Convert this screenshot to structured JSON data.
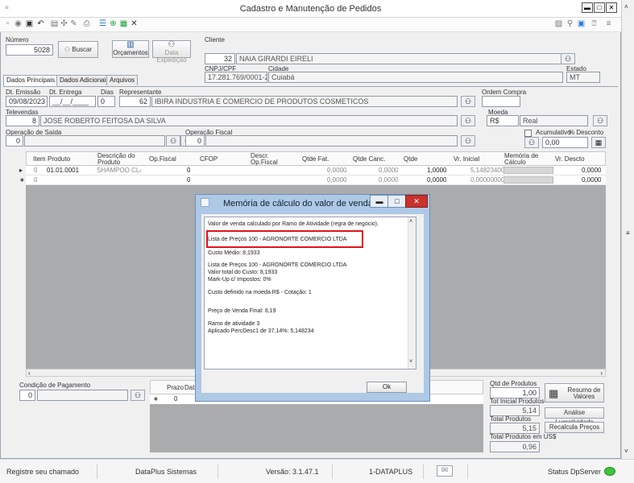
{
  "window": {
    "title": "Cadastro e Manutenção de Pedidos"
  },
  "header": {
    "numero_label": "Número",
    "numero_value": "5028",
    "buscar_label": "Buscar",
    "orcamentos_label": "Orçamentos",
    "data_expedicao_label": "Data Expedição",
    "cliente_label": "Cliente",
    "cliente_code": "32",
    "cliente_name": "NAIA GIRARDI EIRELI",
    "cnpj_label": "CNPJ/CPF",
    "cnpj_value": "17.281.769/0001-28",
    "cidade_label": "Cidade",
    "cidade_value": "Cuiabá",
    "estado_label": "Estado",
    "estado_value": "MT"
  },
  "tabs": [
    "Dados Principais",
    "Dados Adicionais",
    "Arquivos"
  ],
  "form": {
    "dt_emissao_label": "Dt. Emissão",
    "dt_emissao_value": "09/08/2023",
    "dt_entrega_label": "Dt. Entrega",
    "dt_entrega_value": "__/__/____",
    "dias_label": "Dias",
    "dias_value": "0",
    "representante_label": "Representante",
    "representante_code": "62",
    "representante_name": "IBIRA INDUSTRIA E COMERCIO DE PRODUTOS COSMETICOS",
    "ordem_compra_label": "Ordem Compra",
    "televendas_label": "Televendas",
    "televendas_code": "8",
    "televendas_name": "JOSE ROBERTO FEITOSA DA SILVA",
    "moeda_label": "Moeda",
    "moeda_code": "R$",
    "moeda_name": "Real",
    "operacao_saida_label": "Operação de Saída",
    "operacao_saida_value": "0",
    "operacao_fiscal_label": "Operação Fiscal",
    "operacao_fiscal_value": "0",
    "acumulativo_label": "Acumulativo",
    "desconto_label": "% Desconto",
    "desconto_value": "0,00"
  },
  "grid": {
    "columns": [
      "Item",
      "Produto",
      "Descrição do Produto",
      "Op.Fiscal",
      "CFOP",
      "Descr. Op.Fiscal",
      "Qtde Fat.",
      "Qtde Canc.",
      "Qtde",
      "Vr. Inicial",
      "Memória de Cálculo",
      "Vr. Descto"
    ],
    "rows": [
      {
        "marker": "▸",
        "item": "0",
        "produto": "01.01.0001",
        "descricao": "SHAMPOO CLA...",
        "opfiscal": "0",
        "qtde_fat": "0,0000",
        "qtde_canc": "0,0000",
        "qtde": "1,0000",
        "vr_inicial": "5,14823400",
        "vr_descto": "0,0000"
      },
      {
        "marker": "∗",
        "item": "0",
        "produto": "",
        "descricao": "",
        "opfiscal": "0",
        "qtde_fat": "0,0000",
        "qtde_canc": "0,0000",
        "qtde": "0,0000",
        "vr_inicial": "0,00000000",
        "vr_descto": "0,0000"
      }
    ]
  },
  "footer": {
    "condicao_label": "Condição de Pagamento",
    "condicao_value": "0",
    "prazo_label": "Prazo",
    "data_label": "Data",
    "prazo_row_marker": "∗",
    "prazo_row_value": "0",
    "qtd_produtos_label": "Qtd de Produtos",
    "qtd_produtos_value": "1,00",
    "tot_inicial_label": "Tot Inicial Produtos",
    "tot_inicial_value": "5,14",
    "total_produtos_label": "Total Produtos",
    "total_produtos_value": "5,15",
    "total_uss_label": "Total Produtos em US$",
    "total_uss_value": "0,96",
    "resumo_label": "Resumo de Valores",
    "analise_label": "Análise Lucratividade",
    "recalcula_label": "Recalcula Preços"
  },
  "modal": {
    "title": "Memória de cálculo do valor de venda",
    "lines": [
      "Valor de venda calculado por Ramo de Atividade (regra de negócio).",
      "Lista de Preços 100 - AGRONORTE COMERCIO LTDA",
      "Custo Médio: 8,1933",
      "Lista de Preços 100 - AGRONORTE COMERCIO LTDA",
      "Valor total do Custo: 8,1933",
      "Mark-Up c/ Impostos: 0%",
      "Custo definido na moeda R$ - Cotação: 1",
      "Preço de Venda Final: 8,19",
      "Ramo de atividade 3",
      "Aplicado PercDesc1 de 37,14%: 5,148234"
    ],
    "ok_label": "Ok"
  },
  "statusbar": {
    "chamado": "Registre seu chamado",
    "empresa": "DataPlus Sistemas",
    "versao": "Versão: 3.1.47.1",
    "servidor": "1-DATAPLUS",
    "status": "Status DpServer"
  },
  "colors": {
    "highlight": "#e0141c",
    "modal_frame": "#aec9e6",
    "grid_empty": "#aaabad",
    "status_ok": "#3cc23c"
  }
}
